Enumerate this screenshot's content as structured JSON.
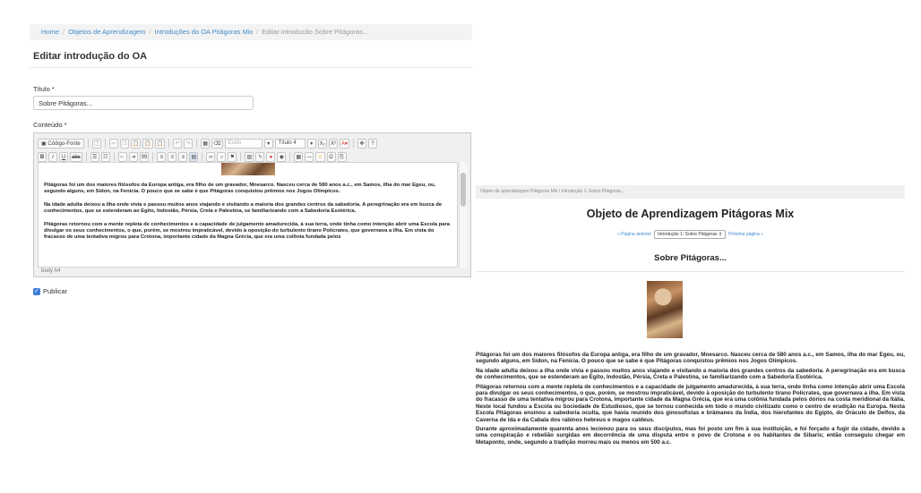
{
  "breadcrumb": {
    "items": [
      "Home",
      "Objetos de Aprendizagem",
      "Introduções do OA Pitágoras Mix"
    ],
    "active": "Editar introducão Sobre Pitágoras..."
  },
  "form": {
    "heading": "Editar introdução do OA",
    "title_label": "Título *",
    "title_value": "Sobre Pitágoras...",
    "content_label": "Conteúdo *",
    "publish_label": "Publicar"
  },
  "editor": {
    "toolbar": {
      "source_label": "Código-Fonte",
      "style_combo": "Estilo",
      "format_combo": "Título 4",
      "bold": "B",
      "italic": "I",
      "underline": "U",
      "strike": "abc",
      "subscript": "X₂",
      "superscript": "X²",
      "text_color": "A",
      "quote": "99"
    },
    "paragraphs": [
      "Pitágoras foi um dos maiores filósofos da Europa antiga, era filho de um gravador, Mnesarco. Nasceu cerca de 580 anos a.c., em Samos, ilha do mar Egeu, ou, segundo alguns, em Sidon, na Fenícia. O pouco que se sabe é que Pitágoras conquistou prêmios nos Jogos Olímpicos.",
      "Na idade adulta deixou a ilha onde vivia e passou muitos anos viajando e visitando a maioria dos grandes centros da sabedoria. A peregrinação era em busca de conhecimentos, que se estenderam ao Egito, Indostão, Pérsia, Creta e Palestina, se familiarizando com a Sabedoria Esotérica.",
      "Pitágoras retornou com a mente repleta de conhecimentos e a capacidade de julgamento amadurecida, à sua terra, onde tinha como intenção abrir uma Escola para divulgar os seus conhecimentos, o que, porém, se mostrou impraticável, devido à oposição do turbulento tirano Policrates, que governava a ilha. Em vista do fracasso de uma tentativa migrou para Crotona, importante cidade da Magna Grécia, que era uma colônia fundada pelos"
    ],
    "status": "body  h4"
  },
  "preview": {
    "breadcrumb": "Objeto de aprendizagem Pitágoras Mix / Introdução 1: Sobre Pitágoras...",
    "title": "Objeto de Aprendizagem Pitágoras Mix",
    "prev_link": "« Página anterior",
    "select_value": "Introdução 1: Sobre Pitágoras",
    "next_link": "Próxima página »",
    "subtitle": "Sobre Pitágoras...",
    "paragraphs": [
      "Pitágoras foi um dos maiores filósofos da Europa antiga, era filho de um gravador, Mnesarco. Nasceu cerca de 580 anos a.c., em Samos, ilha do mar Egeu, ou, segundo alguns, em Sidon, na Fenícia. O pouco que se sabe é que Pitágoras conquistou prêmios nos Jogos Olímpicos.",
      "Na idade adulta deixou a ilha onde vivia e passou muitos anos viajando e visitando a maioria dos grandes centros da sabedoria. A peregrinação era em busca de conhecimentos, que se estenderam ao Egito, Indostão, Pérsia, Creta e Palestina, se familiarizando com a Sabedoria Esotérica.",
      "Pitágoras retornou com a mente repleta de conhecimentos e a capacidade de julgamento amadurecida, à sua terra, onde tinha como intenção abrir uma Escola para divulgar os seus conhecimentos, o que, porém, se mostrou impraticável, devido à oposição do turbulento tirano Policrates, que governava a ilha. Em vista do fracasso de uma tentativa migrou para Crotona, importante cidade da Magna Grécia, que era uma colônia fundada pelos dórios na costa meridional da Itália. Neste local fundou a Escola ou Sociedade de Estudiosos, que se tornou conhecida em todo o mundo civilizado como o centro de erudição na Europa. Nesta Escola Pitágoras ensinou a sabedoria oculta, que havia reunido dos ginosofistas e brâmanes da Índia, dos hierofantes do Egipto, do Oráculo de Delfos, da Caverna de Ida e da Cabala dos rabinos hebreus e magos caldeus.",
      "Durante aproximadamente quarenta anos lecionou para os seus discípulos, mas foi posto um fim à sua instituição, e foi forçado a fugir da cidade, devido a uma conspiração e rebelião surgidas em decorrência de uma disputa entre o povo de Crotona e os habitantes de Sibaris; então conseguiu chegar em Metaponto, onde, segundo a tradição morreu mais ou menos em 500 a.c."
    ]
  },
  "colors": {
    "link": "#428bca",
    "checkbox": "#3b7dd8"
  }
}
